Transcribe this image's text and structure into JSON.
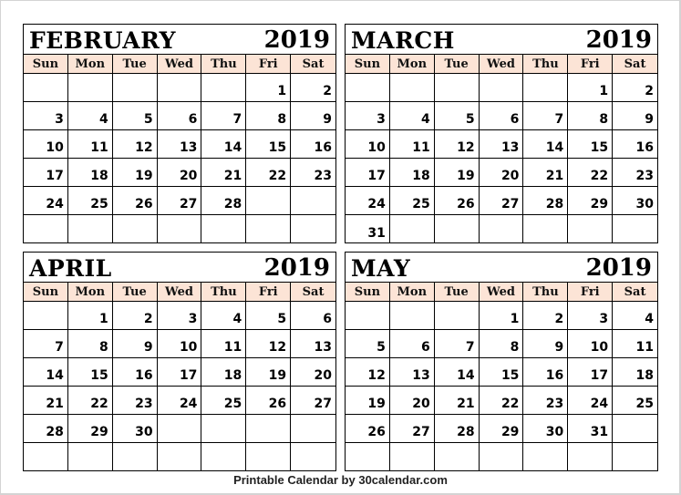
{
  "weekdays": [
    "Sun",
    "Mon",
    "Tue",
    "Wed",
    "Thu",
    "Fri",
    "Sat"
  ],
  "months": [
    {
      "name": "FEBRUARY",
      "year": "2019",
      "weeks": [
        [
          "",
          "",
          "",
          "",
          "",
          "1",
          "2"
        ],
        [
          "3",
          "4",
          "5",
          "6",
          "7",
          "8",
          "9"
        ],
        [
          "10",
          "11",
          "12",
          "13",
          "14",
          "15",
          "16"
        ],
        [
          "17",
          "18",
          "19",
          "20",
          "21",
          "22",
          "23"
        ],
        [
          "24",
          "25",
          "26",
          "27",
          "28",
          "",
          ""
        ],
        [
          "",
          "",
          "",
          "",
          "",
          "",
          ""
        ]
      ]
    },
    {
      "name": "MARCH",
      "year": "2019",
      "weeks": [
        [
          "",
          "",
          "",
          "",
          "",
          "1",
          "2"
        ],
        [
          "3",
          "4",
          "5",
          "6",
          "7",
          "8",
          "9"
        ],
        [
          "10",
          "11",
          "12",
          "13",
          "14",
          "15",
          "16"
        ],
        [
          "17",
          "18",
          "19",
          "20",
          "21",
          "22",
          "23"
        ],
        [
          "24",
          "25",
          "26",
          "27",
          "28",
          "29",
          "30"
        ],
        [
          "31",
          "",
          "",
          "",
          "",
          "",
          ""
        ]
      ]
    },
    {
      "name": "APRIL",
      "year": "2019",
      "weeks": [
        [
          "",
          "1",
          "2",
          "3",
          "4",
          "5",
          "6"
        ],
        [
          "7",
          "8",
          "9",
          "10",
          "11",
          "12",
          "13"
        ],
        [
          "14",
          "15",
          "16",
          "17",
          "18",
          "19",
          "20"
        ],
        [
          "21",
          "22",
          "23",
          "24",
          "25",
          "26",
          "27"
        ],
        [
          "28",
          "29",
          "30",
          "",
          "",
          "",
          ""
        ],
        [
          "",
          "",
          "",
          "",
          "",
          "",
          ""
        ]
      ]
    },
    {
      "name": "MAY",
      "year": "2019",
      "weeks": [
        [
          "",
          "",
          "",
          "1",
          "2",
          "3",
          "4"
        ],
        [
          "5",
          "6",
          "7",
          "8",
          "9",
          "10",
          "11"
        ],
        [
          "12",
          "13",
          "14",
          "15",
          "16",
          "17",
          "18"
        ],
        [
          "19",
          "20",
          "21",
          "22",
          "23",
          "24",
          "25"
        ],
        [
          "26",
          "27",
          "28",
          "29",
          "30",
          "31",
          ""
        ],
        [
          "",
          "",
          "",
          "",
          "",
          "",
          ""
        ]
      ]
    }
  ],
  "colors": {
    "header_bg": "#fce4d6",
    "border": "#000000"
  },
  "footer": "Printable Calendar by 30calendar.com"
}
